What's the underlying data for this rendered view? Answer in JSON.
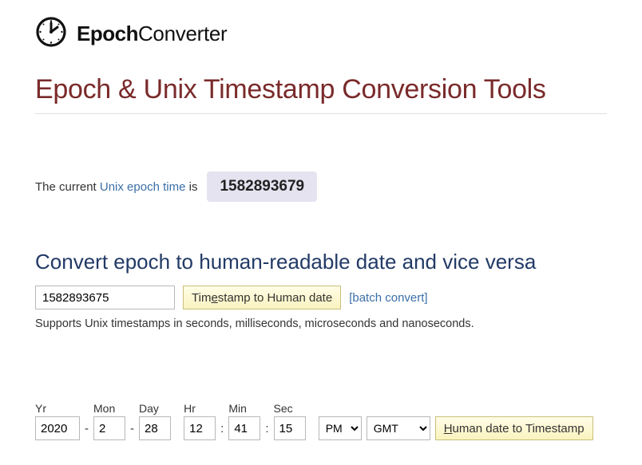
{
  "logo": {
    "bold": "Epoch",
    "light": "Converter"
  },
  "page_title": "Epoch & Unix Timestamp Conversion Tools",
  "current": {
    "prefix": "The current ",
    "link": "Unix epoch time",
    "suffix": " is",
    "value": "1582893679"
  },
  "section1": {
    "title": "Convert epoch to human-readable date and vice versa",
    "input_value": "1582893675",
    "btn_pre": "Tim",
    "btn_u": "e",
    "btn_post": "stamp to Human date",
    "batch": "[batch convert]",
    "support": "Supports Unix timestamps in seconds, milliseconds, microseconds and nanoseconds."
  },
  "date_form": {
    "labels": {
      "yr": "Yr",
      "mon": "Mon",
      "day": "Day",
      "hr": "Hr",
      "min": "Min",
      "sec": "Sec"
    },
    "values": {
      "yr": "2020",
      "mon": "2",
      "day": "28",
      "hr": "12",
      "min": "41",
      "sec": "15"
    },
    "ampm": "PM",
    "tz": "GMT",
    "btn_u": "H",
    "btn_post": "uman date to Timestamp"
  }
}
